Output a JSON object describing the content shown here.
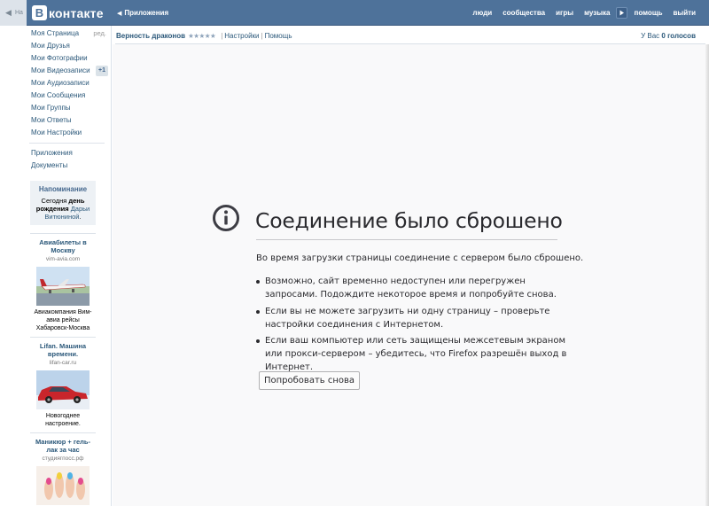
{
  "topbar": {
    "back_label": "На",
    "logo_letter": "В",
    "logo_text": "контакте",
    "apps_label": "Приложения",
    "nav": [
      {
        "label": "люди"
      },
      {
        "label": "сообщества"
      },
      {
        "label": "игры"
      },
      {
        "label": "музыка"
      },
      {
        "label": "помощь"
      },
      {
        "label": "выйти"
      }
    ],
    "play_icon": "play-icon"
  },
  "sidebar": {
    "items": [
      {
        "label": "Моя Страница",
        "extra": "ред."
      },
      {
        "label": "Мои Друзья"
      },
      {
        "label": "Мои Фотографии"
      },
      {
        "label": "Мои Видеозаписи",
        "badge": "+1"
      },
      {
        "label": "Мои Аудиозаписи"
      },
      {
        "label": "Мои Сообщения"
      },
      {
        "label": "Мои Группы"
      },
      {
        "label": "Мои Ответы"
      },
      {
        "label": "Мои Настройки"
      }
    ],
    "items2": [
      {
        "label": "Приложения"
      },
      {
        "label": "Документы"
      }
    ],
    "reminder": {
      "title": "Напоминание",
      "text_pre": "Сегодня ",
      "text_bold": "день рождения",
      "text_link": "Дарьи Витюниной",
      "text_end": "."
    },
    "ads": [
      {
        "title": "Авиабилеты в Москву",
        "domain": "vim-avia.com",
        "text": "Авиакомпания Вим-авиа рейсы Хабаровск-Москва"
      },
      {
        "title": "Lifan. Машина времени.",
        "domain": "lifan-car.ru",
        "text": "Новогоднее настроение."
      },
      {
        "title": "Маникюр + гель-лак за час",
        "domain": "студиягпосс.рф",
        "text": ""
      }
    ]
  },
  "app_header": {
    "name": "Верность драконов",
    "stars": "★★★★★",
    "settings": "Настройки",
    "help": "Помощь",
    "votes_pre": "У Вас ",
    "votes_bold": "0 голосов"
  },
  "error": {
    "title": "Соединение было сброшено",
    "description": "Во время загрузки страницы соединение с сервером было сброшено.",
    "bullets": [
      "Возможно, сайт временно недоступен или перегружен запросами. Подождите некоторое время и попробуйте снова.",
      "Если вы не можете загрузить ни одну страницу – проверьте настройки соединения с Интернетом.",
      "Если ваш компьютер или сеть защищены межсетевым экраном или прокси-сервером – убедитесь, что Firefox разрешён выход в Интернет."
    ],
    "retry_label": "Попробовать снова"
  },
  "colors": {
    "header_bg": "#4e729a",
    "link": "#2b587a",
    "error_text": "#2a2a2e"
  }
}
